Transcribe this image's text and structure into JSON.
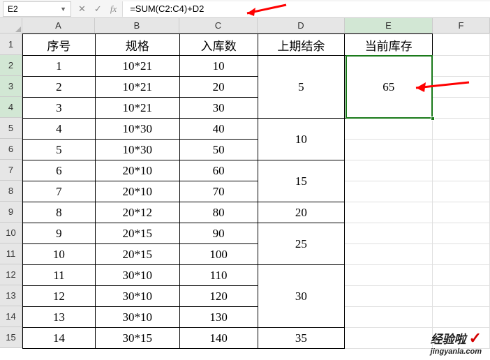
{
  "formulaBar": {
    "nameBox": "E2",
    "formula": "=SUM(C2:C4)+D2"
  },
  "columns": [
    "A",
    "B",
    "C",
    "D",
    "E",
    "F"
  ],
  "rowNums": [
    "1",
    "2",
    "3",
    "4",
    "5",
    "6",
    "7",
    "8",
    "9",
    "10",
    "11",
    "12",
    "13",
    "14",
    "15"
  ],
  "headers": {
    "a": "序号",
    "b": "规格",
    "c": "入库数",
    "d": "上期结余",
    "e": "当前库存"
  },
  "rows": [
    {
      "a": "1",
      "b": "10*21",
      "c": "10"
    },
    {
      "a": "2",
      "b": "10*21",
      "c": "20"
    },
    {
      "a": "3",
      "b": "10*21",
      "c": "30"
    },
    {
      "a": "4",
      "b": "10*30",
      "c": "40"
    },
    {
      "a": "5",
      "b": "10*30",
      "c": "50"
    },
    {
      "a": "6",
      "b": "20*10",
      "c": "60"
    },
    {
      "a": "7",
      "b": "20*10",
      "c": "70"
    },
    {
      "a": "8",
      "b": "20*12",
      "c": "80"
    },
    {
      "a": "9",
      "b": "20*15",
      "c": "90"
    },
    {
      "a": "10",
      "b": "20*15",
      "c": "100"
    },
    {
      "a": "11",
      "b": "30*10",
      "c": "110"
    },
    {
      "a": "12",
      "b": "30*10",
      "c": "120"
    },
    {
      "a": "13",
      "b": "30*10",
      "c": "130"
    },
    {
      "a": "14",
      "b": "30*15",
      "c": "140"
    }
  ],
  "dGroups": [
    {
      "span": 3,
      "val": "5"
    },
    {
      "span": 2,
      "val": "10"
    },
    {
      "span": 2,
      "val": "15"
    },
    {
      "span": 1,
      "val": "20"
    },
    {
      "span": 2,
      "val": "25"
    },
    {
      "span": 3,
      "val": "30"
    },
    {
      "span": 1,
      "val": "35"
    }
  ],
  "eVal": "65",
  "watermark": {
    "top": "经验啦",
    "bot": "jingyanla.com"
  },
  "chart_data": {
    "type": "table",
    "title": "",
    "columns": [
      "序号",
      "规格",
      "入库数",
      "上期结余",
      "当前库存"
    ],
    "data": [
      [
        "1",
        "10*21",
        10,
        5,
        65
      ],
      [
        "2",
        "10*21",
        20,
        5,
        65
      ],
      [
        "3",
        "10*21",
        30,
        5,
        65
      ],
      [
        "4",
        "10*30",
        40,
        10,
        null
      ],
      [
        "5",
        "10*30",
        50,
        10,
        null
      ],
      [
        "6",
        "20*10",
        60,
        15,
        null
      ],
      [
        "7",
        "20*10",
        70,
        15,
        null
      ],
      [
        "8",
        "20*12",
        80,
        20,
        null
      ],
      [
        "9",
        "20*15",
        90,
        25,
        null
      ],
      [
        "10",
        "20*15",
        100,
        25,
        null
      ],
      [
        "11",
        "30*10",
        110,
        30,
        null
      ],
      [
        "12",
        "30*10",
        120,
        30,
        null
      ],
      [
        "13",
        "30*10",
        130,
        30,
        null
      ],
      [
        "14",
        "30*15",
        140,
        35,
        null
      ]
    ]
  }
}
